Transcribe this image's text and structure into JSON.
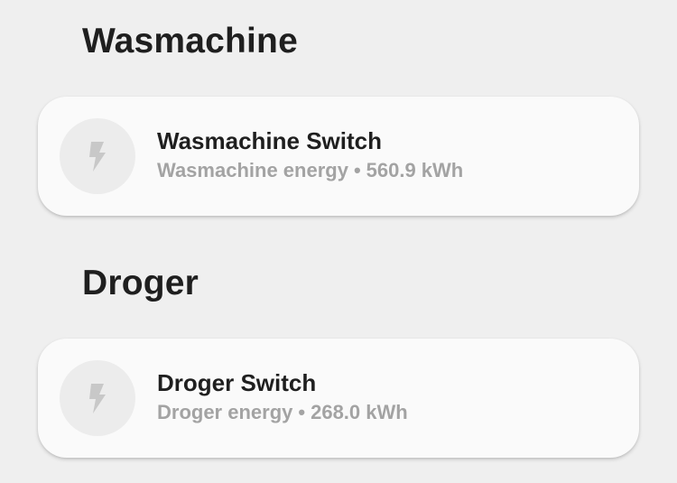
{
  "sections": [
    {
      "title": "Wasmachine",
      "card": {
        "title": "Wasmachine Switch",
        "sensor": "Wasmachine energy",
        "separator": "•",
        "value": "560.9 kWh",
        "icon": "flash-icon"
      }
    },
    {
      "title": "Droger",
      "card": {
        "title": "Droger Switch",
        "sensor": "Droger energy",
        "separator": "•",
        "value": "268.0 kWh",
        "icon": "flash-icon"
      }
    }
  ],
  "colors": {
    "background": "#efefef",
    "card": "#fafafa",
    "icon_circle": "#ececec",
    "icon": "#c8c8c8",
    "title_text": "#1f1f1f",
    "secondary_text": "#a3a3a3"
  }
}
